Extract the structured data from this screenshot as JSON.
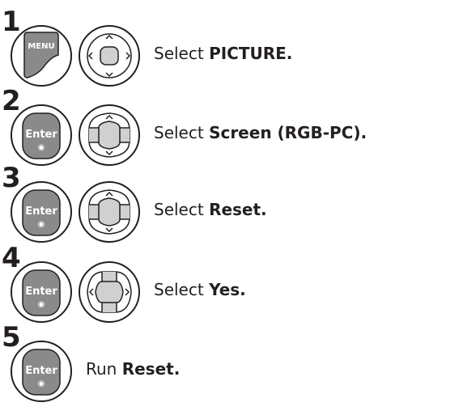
{
  "steps": [
    {
      "number": "1",
      "buttons": [
        "menu-key",
        "nav-4way"
      ],
      "text_prefix": "Select ",
      "text_bold": "PICTURE."
    },
    {
      "number": "2",
      "buttons": [
        "enter-key",
        "nav-updown"
      ],
      "text_prefix": "Select ",
      "text_bold": "Screen (RGB-PC)."
    },
    {
      "number": "3",
      "buttons": [
        "enter-key",
        "nav-updown"
      ],
      "text_prefix": "Select ",
      "text_bold": "Reset."
    },
    {
      "number": "4",
      "buttons": [
        "enter-key",
        "nav-leftright"
      ],
      "text_prefix": "Select ",
      "text_bold": "Yes."
    },
    {
      "number": "5",
      "buttons": [
        "enter-key"
      ],
      "text_prefix": "Run ",
      "text_bold": "Reset."
    }
  ],
  "key_labels": {
    "menu": "MENU",
    "enter": "Enter",
    "enter_dot": "◉"
  }
}
